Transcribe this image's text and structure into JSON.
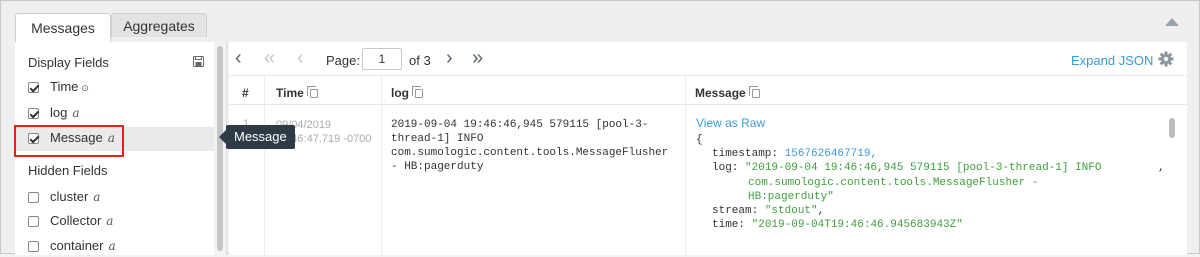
{
  "tabs": {
    "messages": "Messages",
    "aggregates": "Aggregates"
  },
  "left": {
    "display_title": "Display Fields",
    "hidden_title": "Hidden Fields",
    "display_fields": [
      {
        "label": "Time",
        "type": "⊙",
        "checked": true
      },
      {
        "label": "log",
        "type": "a",
        "checked": true
      },
      {
        "label": "Message",
        "type": "a",
        "checked": true
      }
    ],
    "hidden_fields": [
      {
        "label": "cluster",
        "type": "a",
        "checked": false
      },
      {
        "label": "Collector",
        "type": "a",
        "checked": false
      },
      {
        "label": "container",
        "type": "a",
        "checked": false
      }
    ]
  },
  "tooltip": "Message",
  "toolbar": {
    "page_label": "Page:",
    "page_value": "1",
    "page_of": "of 3",
    "expand_json": "Expand JSON"
  },
  "table": {
    "headers": {
      "num": "#",
      "time": "Time",
      "log": "log",
      "message": "Message"
    },
    "row": {
      "num": "1",
      "date": "09/04/2019",
      "time": "19:46:47.719 -0700",
      "log": [
        "2019-09-04 19:46:46,945 579115 [pool-3-",
        "thread-1] INFO",
        "com.sumologic.content.tools.MessageFlusher",
        "- HB:pagerduty"
      ],
      "view_raw": "View as Raw",
      "json": {
        "open": "{",
        "timestamp_key": "timestamp:",
        "timestamp_val": "1567626467719,",
        "log_key": "log:",
        "log_val1": "\"2019-09-04 19:46:46,945 579115 [pool-3-thread-1] INFO",
        "log_val2": "com.sumologic.content.tools.MessageFlusher  -",
        "log_val3": "HB:pagerduty\"",
        "log_comma": ",",
        "stream_key": "stream:",
        "stream_val": "\"stdout\"",
        "stream_comma": ",",
        "time_key": "time:",
        "time_val": "\"2019-09-04T19:46:46.945683943Z\""
      }
    }
  },
  "colors": {
    "accent": "#3b9ad7",
    "highlight": "#e2231a",
    "string": "#3e9e3e"
  }
}
